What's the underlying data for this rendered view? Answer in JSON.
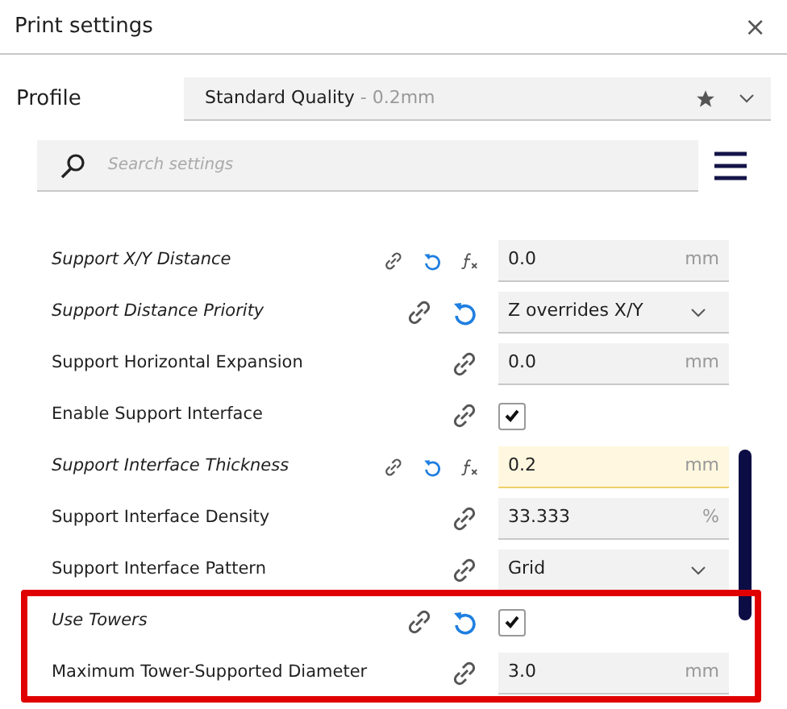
{
  "window": {
    "title": "Print settings",
    "close": "×"
  },
  "profile": {
    "label": "Profile",
    "value": "Standard Quality",
    "detail": " - 0.2mm"
  },
  "search": {
    "placeholder": "Search settings"
  },
  "settings": [
    {
      "label": "Support X/Y Distance",
      "modified": true,
      "linked": true,
      "resettable": true,
      "formula": true,
      "kind": "number",
      "value": "0.0",
      "unit": "mm",
      "warning": false
    },
    {
      "label": "Support Distance Priority",
      "modified": true,
      "linked": true,
      "resettable": true,
      "formula": false,
      "kind": "select",
      "value": "Z overrides X/Y"
    },
    {
      "label": "Support Horizontal Expansion",
      "modified": false,
      "linked": true,
      "resettable": false,
      "formula": false,
      "kind": "number",
      "value": "0.0",
      "unit": "mm",
      "warning": false
    },
    {
      "label": "Enable Support Interface",
      "modified": false,
      "linked": true,
      "resettable": false,
      "formula": false,
      "kind": "checkbox",
      "checked": true
    },
    {
      "label": "Support Interface Thickness",
      "modified": true,
      "linked": true,
      "resettable": true,
      "formula": true,
      "kind": "number",
      "value": "0.2",
      "unit": "mm",
      "warning": true
    },
    {
      "label": "Support Interface Density",
      "modified": false,
      "linked": true,
      "resettable": false,
      "formula": false,
      "kind": "number",
      "value": "33.333",
      "unit": "%",
      "warning": false
    },
    {
      "label": "Support Interface Pattern",
      "modified": false,
      "linked": true,
      "resettable": false,
      "formula": false,
      "kind": "select",
      "value": "Grid"
    },
    {
      "label": "Use Towers",
      "modified": true,
      "linked": true,
      "resettable": true,
      "formula": false,
      "kind": "checkbox",
      "checked": true
    },
    {
      "label": "Maximum Tower-Supported Diameter",
      "modified": false,
      "linked": true,
      "resettable": false,
      "formula": false,
      "kind": "number",
      "value": "3.0",
      "unit": "mm",
      "warning": false
    }
  ]
}
